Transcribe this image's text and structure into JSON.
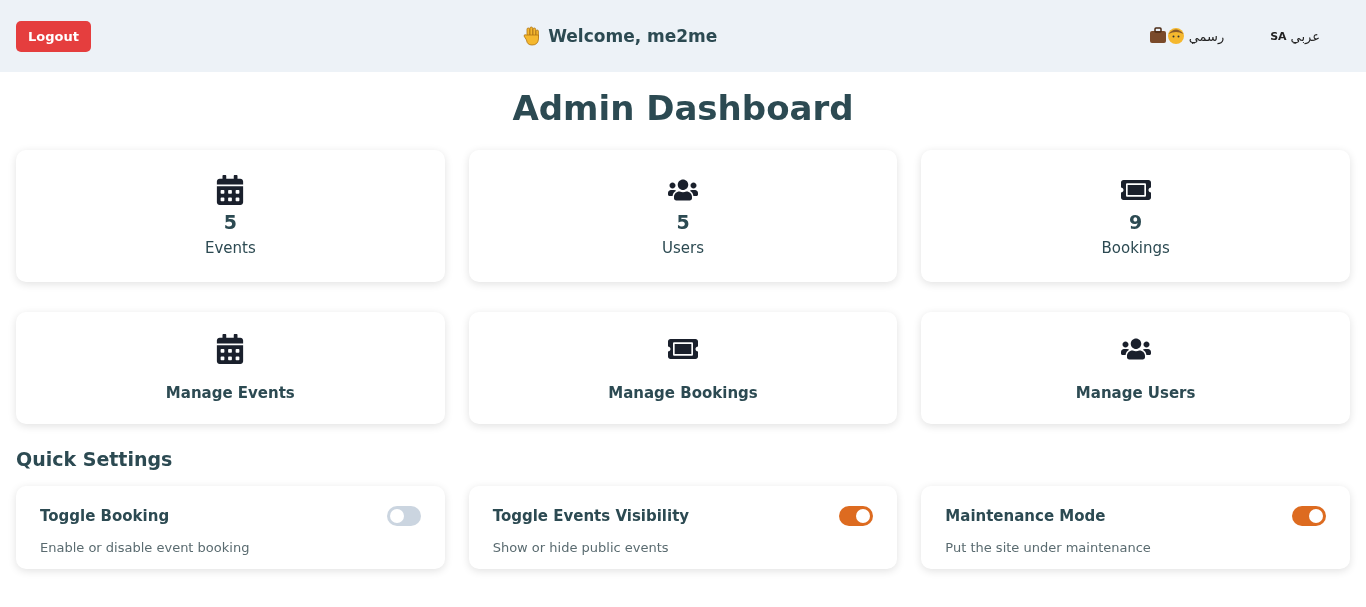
{
  "header": {
    "logout": "Logout",
    "welcome": "Welcome, me2me",
    "style_option": "رسمي",
    "language_code": "SA",
    "language": "عربي"
  },
  "title": "Admin Dashboard",
  "stats": [
    {
      "kind": "calendar",
      "value": "5",
      "label": "Events"
    },
    {
      "kind": "users",
      "value": "5",
      "label": "Users"
    },
    {
      "kind": "ticket",
      "value": "9",
      "label": "Bookings"
    }
  ],
  "manage": [
    {
      "kind": "calendar",
      "label": "Manage Events"
    },
    {
      "kind": "ticket",
      "label": "Manage Bookings"
    },
    {
      "kind": "users",
      "label": "Manage Users"
    }
  ],
  "quick_settings": {
    "heading": "Quick Settings",
    "items": [
      {
        "title": "Toggle Booking",
        "description": "Enable or disable event booking",
        "on": false
      },
      {
        "title": "Toggle Events Visibility",
        "description": "Show or hide public events",
        "on": true
      },
      {
        "title": "Maintenance Mode",
        "description": "Put the site under maintenance",
        "on": true
      }
    ]
  }
}
